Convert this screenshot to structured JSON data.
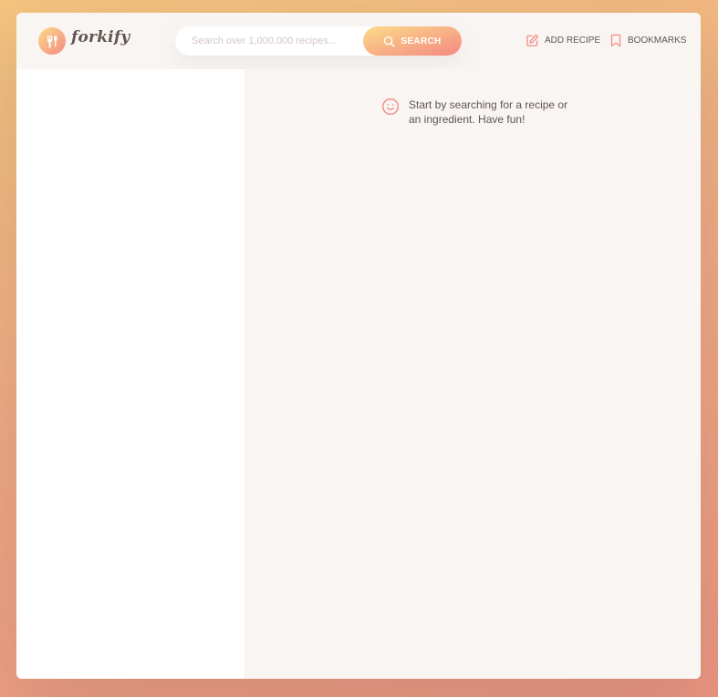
{
  "brand": {
    "name": "forkify",
    "logo_icon": "fork-spoon-icon"
  },
  "search": {
    "placeholder": "Search over 1,000,000 recipes...",
    "value": "",
    "button_label": "SEARCH",
    "button_icon": "search-icon"
  },
  "nav": {
    "add_recipe_label": "ADD RECIPE",
    "add_recipe_icon": "edit-icon",
    "bookmarks_label": "BOOKMARKS",
    "bookmarks_icon": "bookmark-icon"
  },
  "recipe": {
    "message": "Start by searching for a recipe or an ingredient. Have fun!",
    "message_icon": "smile-icon"
  },
  "colors": {
    "accent": "#f38e82",
    "gradient_start": "#fbdb89",
    "gradient_end": "#f48982",
    "text": "#615551",
    "panel_bg": "#f9f5f3"
  }
}
